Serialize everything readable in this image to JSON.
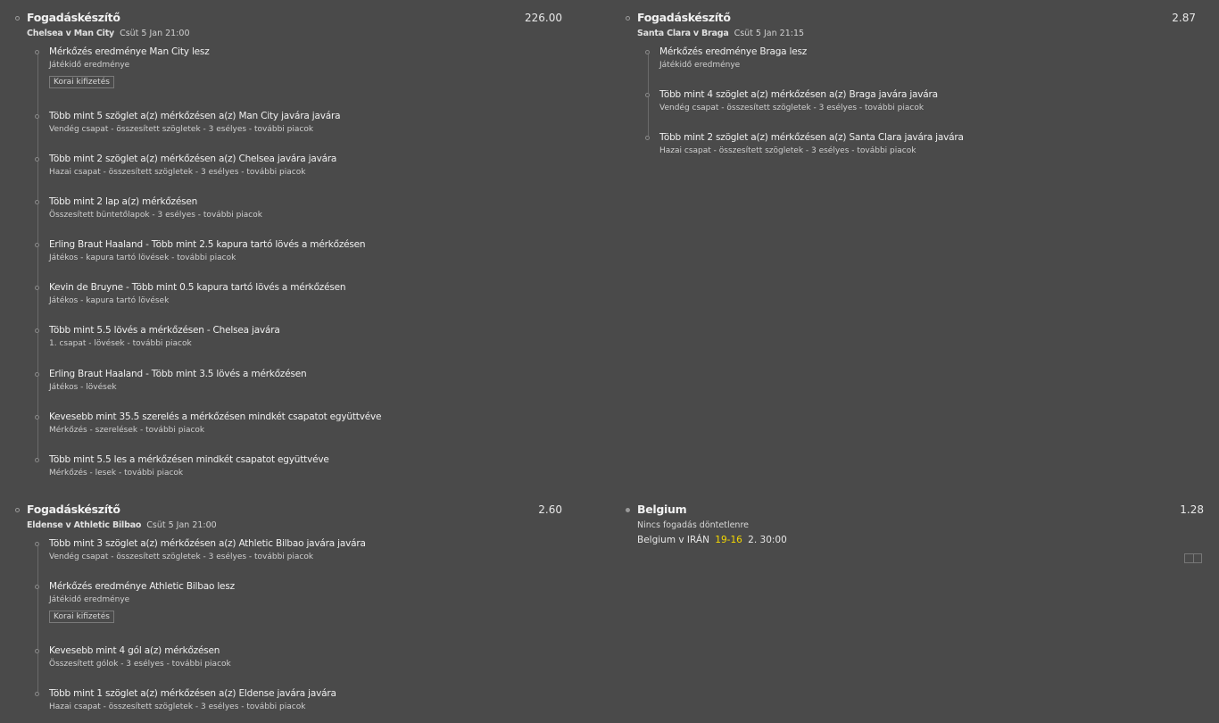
{
  "card1": {
    "title": "Fogadáskészítő",
    "odds": "226.00",
    "match": "Chelsea v Man City",
    "time": "Csüt 5 Jan 21:00",
    "legs": [
      {
        "name": "Mérkőzés eredménye Man City lesz",
        "market": "Játékidő eredménye",
        "badge": "Korai kifizetés"
      },
      {
        "name": "Több mint 5 szöglet a(z) mérkőzésen a(z) Man City javára javára",
        "market": "Vendég csapat - összesített szögletek - 3 esélyes - további piacok"
      },
      {
        "name": "Több mint 2 szöglet a(z) mérkőzésen a(z) Chelsea javára javára",
        "market": "Hazai csapat - összesített szögletek - 3 esélyes - további piacok"
      },
      {
        "name": "Több mint 2 lap a(z) mérkőzésen",
        "market": "Összesített büntetőlapok - 3 esélyes - további piacok"
      },
      {
        "name": "Erling Braut Haaland - Több mint 2.5 kapura tartó lövés a mérkőzésen",
        "market": "Játékos - kapura tartó lövések - további piacok"
      },
      {
        "name": "Kevin de Bruyne - Több mint 0.5 kapura tartó lövés a mérkőzésen",
        "market": "Játékos - kapura tartó lövések"
      },
      {
        "name": "Több mint 5.5 lövés a mérkőzésen - Chelsea javára",
        "market": "1. csapat - lövések - további piacok"
      },
      {
        "name": "Erling Braut Haaland - Több mint 3.5 lövés a mérkőzésen",
        "market": "Játékos - lövések"
      },
      {
        "name": "Kevesebb mint 35.5 szerelés a mérkőzésen mindkét csapatot együttvéve",
        "market": "Mérkőzés - szerelések - további piacok"
      },
      {
        "name": "Több mint 5.5 les a mérkőzésen mindkét csapatot együttvéve",
        "market": "Mérkőzés - lesek - további piacok"
      }
    ]
  },
  "card2": {
    "title": "Fogadáskészítő",
    "odds": "2.87",
    "match": "Santa Clara v Braga",
    "time": "Csüt 5 Jan 21:15",
    "legs": [
      {
        "name": "Mérkőzés eredménye Braga lesz",
        "market": "Játékidő eredménye"
      },
      {
        "name": "Több mint 4 szöglet a(z) mérkőzésen a(z) Braga javára javára",
        "market": "Vendég csapat - összesített szögletek - 3 esélyes - további piacok"
      },
      {
        "name": "Több mint 2 szöglet a(z) mérkőzésen a(z) Santa Clara javára javára",
        "market": "Hazai csapat - összesített szögletek - 3 esélyes - további piacok"
      }
    ]
  },
  "card3": {
    "title": "Fogadáskészítő",
    "odds": "2.60",
    "match": "Eldense v Athletic Bilbao",
    "time": "Csüt 5 Jan 21:00",
    "legs": [
      {
        "name": "Több mint 3 szöglet a(z) mérkőzésen a(z) Athletic Bilbao javára javára",
        "market": "Vendég csapat - összesített szögletek - 3 esélyes - további piacok"
      },
      {
        "name": "Mérkőzés eredménye Athletic Bilbao lesz",
        "market": "Játékidő eredménye",
        "badge": "Korai kifizetés"
      },
      {
        "name": "Kevesebb mint 4 gól a(z) mérkőzésen",
        "market": "Összesített gólok - 3 esélyes - további piacok"
      },
      {
        "name": "Több mint 1 szöglet a(z) mérkőzésen a(z) Eldense javára javára",
        "market": "Hazai csapat - összesített szögletek - 3 esélyes - további piacok"
      }
    ]
  },
  "card4": {
    "title": "Belgium",
    "odds": "1.28",
    "subtitle": "Nincs fogadás döntetlenre",
    "match": "Belgium v IRÁN",
    "score": "19-16",
    "period": "2. 30:00"
  },
  "colors": {
    "background": "#4a4a4a",
    "score": "#f5d800"
  }
}
